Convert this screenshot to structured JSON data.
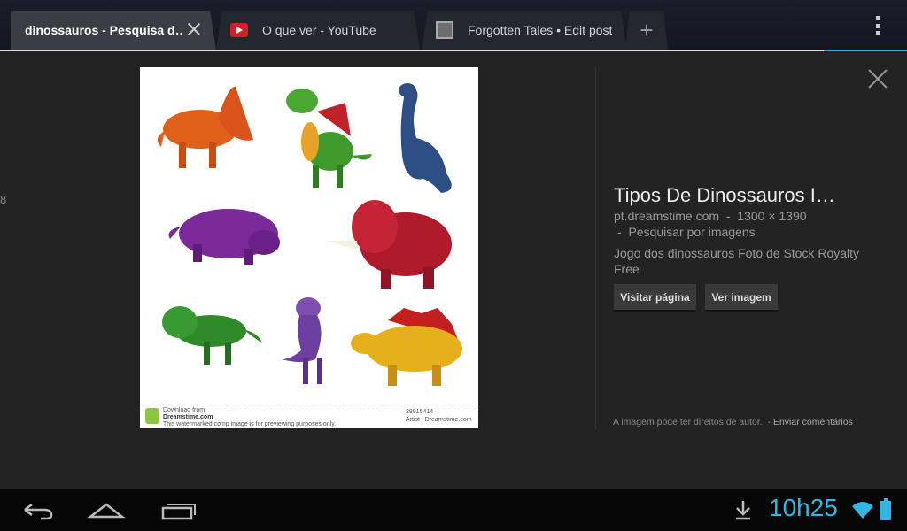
{
  "tabs": [
    {
      "label": "dinossauros - Pesquisa d…",
      "active": true
    },
    {
      "label": "O que ver - YouTube",
      "icon": "youtube-icon"
    },
    {
      "label": "Forgotten Tales • Edit post",
      "icon": "blog-icon"
    }
  ],
  "newtab_label": "+",
  "edge_number": "8",
  "image_footer": {
    "download_line1": "Download from",
    "download_line2": "Dreamstime.com",
    "fine_print": "This watermarked comp image is for previewing purposes only.",
    "id_line": "28915414",
    "author_line": "Artist | Dreamstime.com"
  },
  "info": {
    "title": "Tipos De Dinossauros I…",
    "source": "pt.dreamstime.com",
    "dimensions": "1300 × 1390",
    "search_link": "Pesquisar por imagens",
    "description": "Jogo dos dinossauros Foto de Stock Royalty Free",
    "visit_button": "Visitar página",
    "view_button": "Ver imagem",
    "copyright": "A imagem pode ter direitos de autor.",
    "feedback_link": "Enviar comentários"
  },
  "status": {
    "clock": "10h25"
  },
  "colors": {
    "accent": "#33b5e5",
    "background": "#232323"
  }
}
